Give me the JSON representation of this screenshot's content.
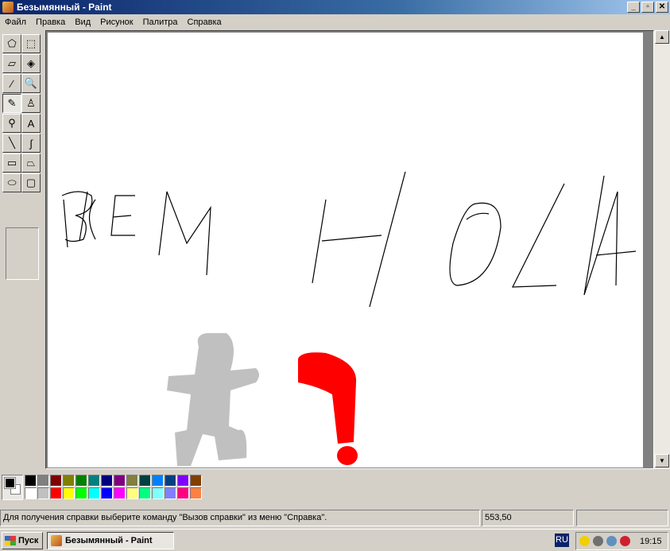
{
  "window": {
    "title": "Безымянный - Paint",
    "minimize": "_",
    "maximize": "▫",
    "close": "✕"
  },
  "menu": [
    "Файл",
    "Правка",
    "Вид",
    "Рисунок",
    "Палитра",
    "Справка"
  ],
  "tools": [
    {
      "name": "free-select",
      "glyph": "⬠"
    },
    {
      "name": "rect-select",
      "glyph": "⬚"
    },
    {
      "name": "eraser",
      "glyph": "▱"
    },
    {
      "name": "fill",
      "glyph": "◈"
    },
    {
      "name": "color-picker",
      "glyph": "⁄"
    },
    {
      "name": "magnifier",
      "glyph": "🔍"
    },
    {
      "name": "pencil",
      "glyph": "✎"
    },
    {
      "name": "brush",
      "glyph": "♙"
    },
    {
      "name": "airbrush",
      "glyph": "⚲"
    },
    {
      "name": "text",
      "glyph": "A"
    },
    {
      "name": "line",
      "glyph": "╲"
    },
    {
      "name": "curve",
      "glyph": "∫"
    },
    {
      "name": "rectangle",
      "glyph": "▭"
    },
    {
      "name": "polygon",
      "glyph": "⏢"
    },
    {
      "name": "ellipse",
      "glyph": "⬭"
    },
    {
      "name": "rounded-rect",
      "glyph": "▢"
    }
  ],
  "selected_tool": "pencil",
  "palette": {
    "foreground": "#000000",
    "background": "#ffffff",
    "row1": [
      "#000000",
      "#808080",
      "#800000",
      "#808000",
      "#008000",
      "#008080",
      "#000080",
      "#800080",
      "#808040",
      "#004040",
      "#0080ff",
      "#004080",
      "#8000ff",
      "#804000"
    ],
    "row2": [
      "#ffffff",
      "#c0c0c0",
      "#ff0000",
      "#ffff00",
      "#00ff00",
      "#00ffff",
      "#0000ff",
      "#ff00ff",
      "#ffff80",
      "#00ff80",
      "#80ffff",
      "#8080ff",
      "#ff0080",
      "#ff8040"
    ]
  },
  "status": {
    "help": "Для получения справки выберите команду \"Вызов справки\" из меню \"Справка\".",
    "coords": "553,50",
    "size": ""
  },
  "taskbar": {
    "start": "Пуск",
    "task": "Безымянный - Paint",
    "lang": "RU",
    "clock": "19:15"
  },
  "tray_icons": [
    "security-shield-icon",
    "speaker-icon",
    "network-icon",
    "antivirus-icon"
  ]
}
